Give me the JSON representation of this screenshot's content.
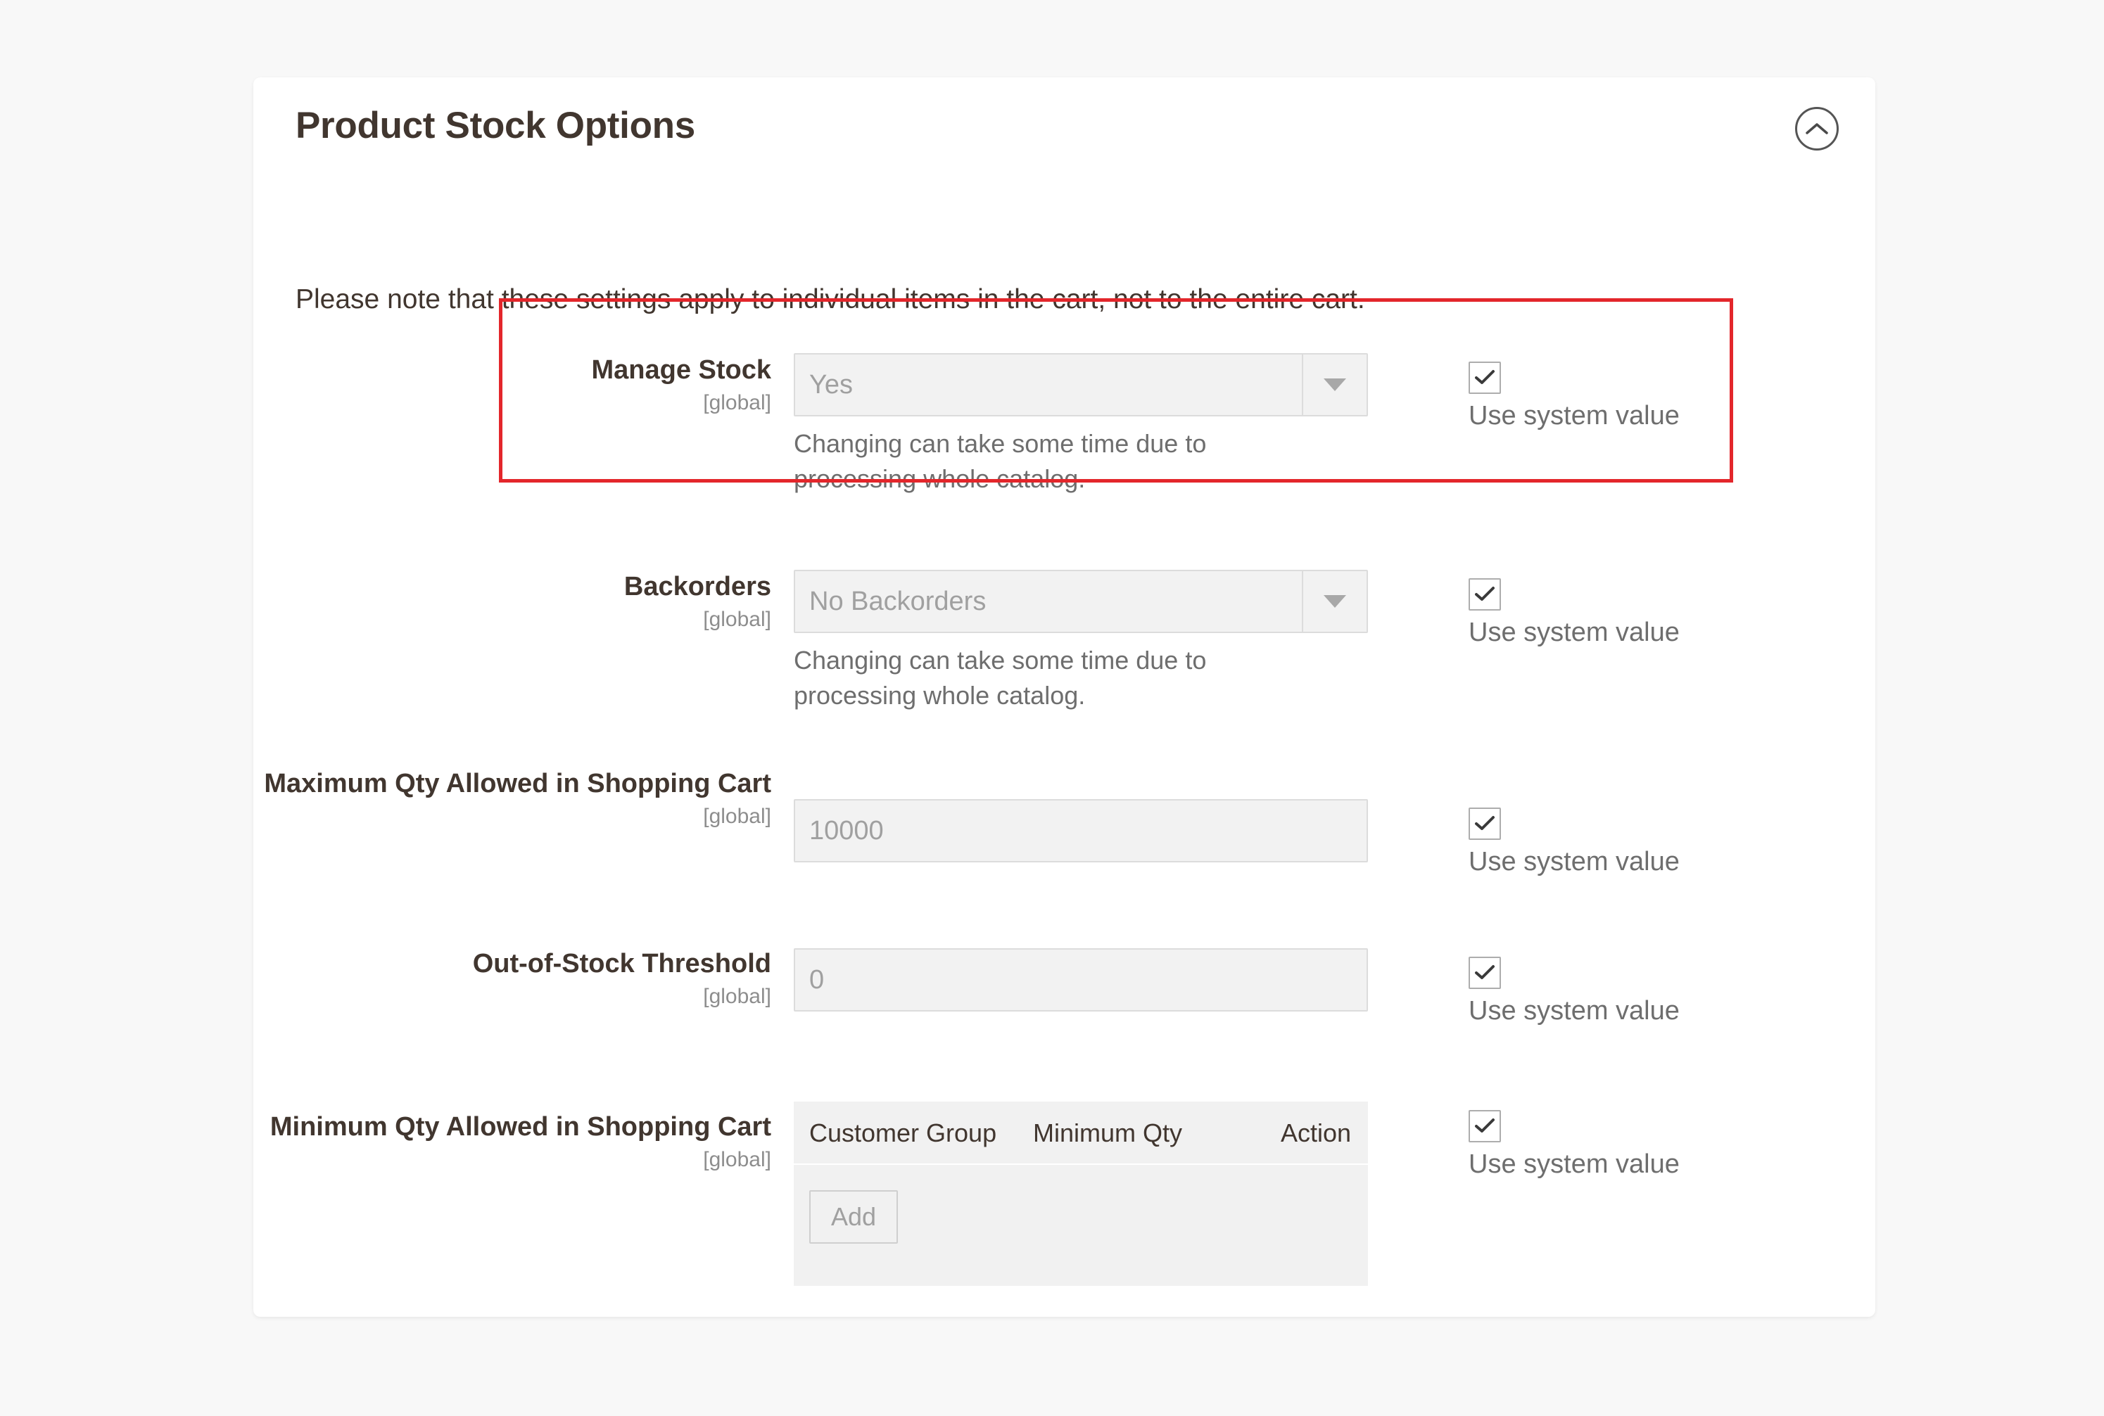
{
  "section": {
    "title": "Product Stock Options",
    "collapse_icon": "chevron-up-circle-icon",
    "intro_note": "Please note that these settings apply to individual items in the cart, not to the entire cart.",
    "scope_tag": "[global]",
    "system_value_label": "Use system value",
    "accent_highlight_color": "#e3262b",
    "panel_background": "#ffffff",
    "page_background": "#f8f8f8"
  },
  "fields": [
    {
      "label": "Manage Stock",
      "scope": "[global]",
      "type": "select",
      "value": "Yes",
      "note": "Changing can take some time due to processing whole catalog.",
      "use_system_value": true,
      "highlighted": true
    },
    {
      "label": "Backorders",
      "scope": "[global]",
      "type": "select",
      "value": "No Backorders",
      "note": "Changing can take some time due to processing whole catalog.",
      "use_system_value": true,
      "highlighted": false
    },
    {
      "label": "Maximum Qty Allowed in Shopping Cart",
      "scope": "[global]",
      "type": "text",
      "value": "10000",
      "note": "",
      "use_system_value": true,
      "highlighted": false
    },
    {
      "label": "Out-of-Stock Threshold",
      "scope": "[global]",
      "type": "text",
      "value": "0",
      "note": "",
      "use_system_value": true,
      "highlighted": false
    },
    {
      "label": "Minimum Qty Allowed in Shopping Cart",
      "scope": "[global]",
      "type": "table",
      "use_system_value": true,
      "highlighted": false
    }
  ],
  "minqty_table": {
    "columns": [
      "Customer Group",
      "Minimum Qty",
      "Action"
    ],
    "rows": [],
    "add_button_label": "Add"
  }
}
